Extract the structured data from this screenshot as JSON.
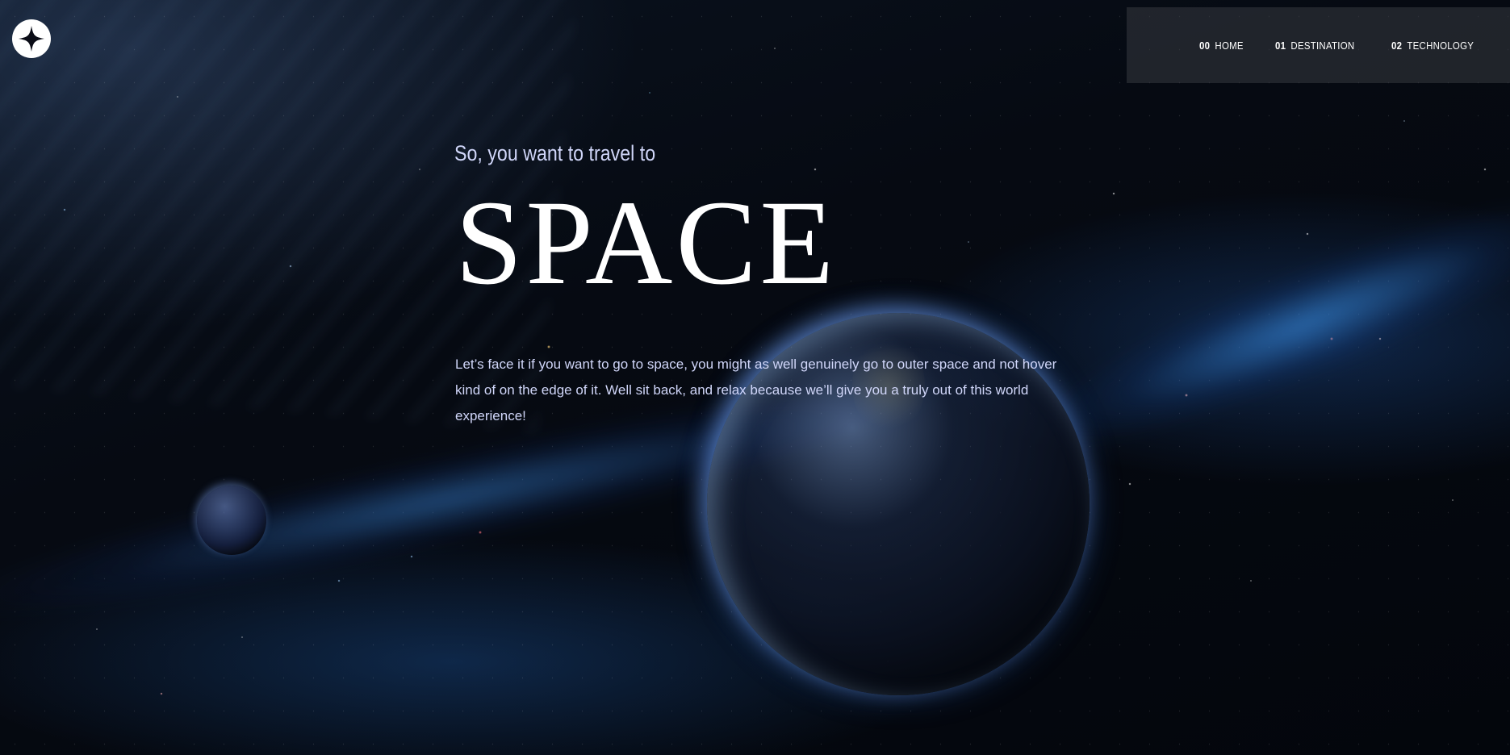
{
  "logo": {
    "icon": "star-logo-icon"
  },
  "nav": {
    "items": [
      {
        "num": "00",
        "label": "HOME"
      },
      {
        "num": "01",
        "label": "DESTINATION"
      },
      {
        "num": "02",
        "label": "TECHNOLOGY"
      }
    ]
  },
  "hero": {
    "subtitle": "So, you want to travel to",
    "title": "SPACE",
    "description": "Let’s face it if you want to go to space, you might as well genuinely go to outer space and not hover kind of on the edge of it. Well sit back, and relax because we’ll give you a truly out of this world experience!"
  },
  "colors": {
    "background": "#05080f",
    "text_primary": "#ffffff",
    "text_secondary": "#d0d6f9",
    "nav_background": "#373a40"
  }
}
